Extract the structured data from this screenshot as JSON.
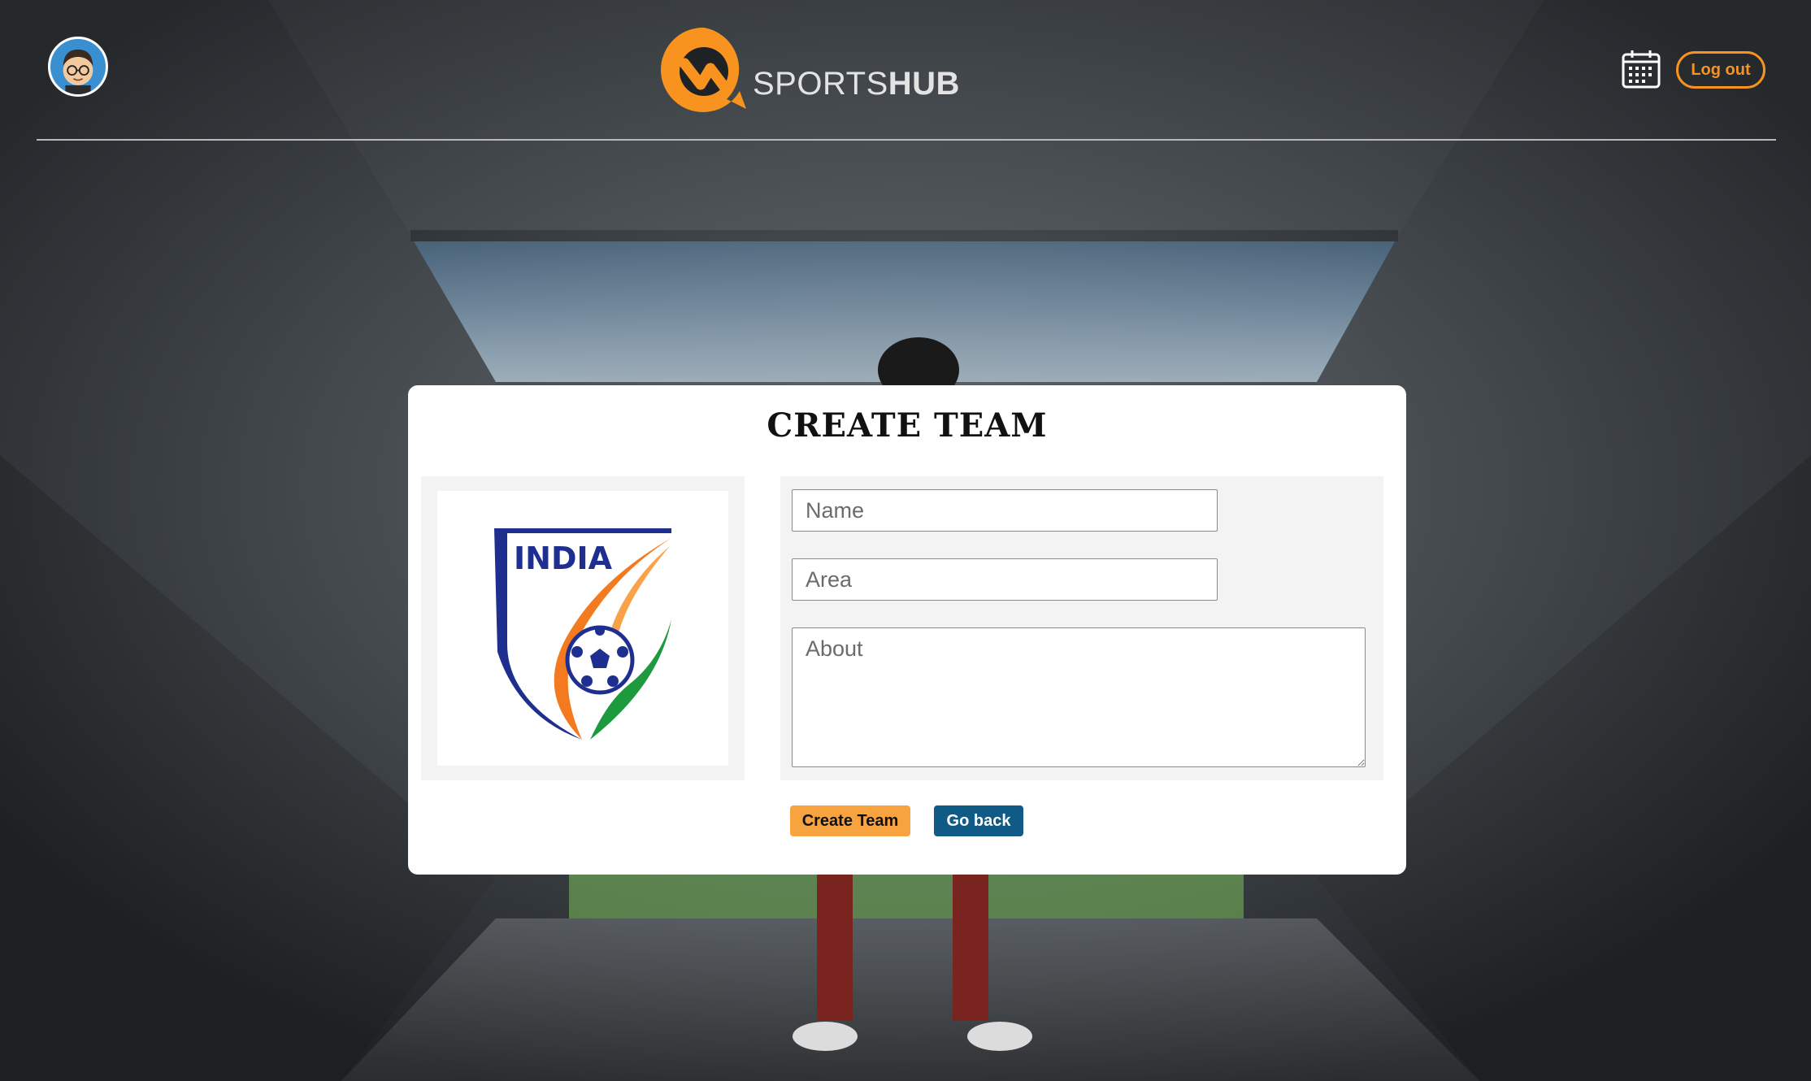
{
  "header": {
    "brand_light": "SPORTS",
    "brand_bold": "HUB",
    "logout_label": "Log out"
  },
  "card": {
    "title": "CREATE TEAM",
    "logo_text": "INDIA",
    "fields": {
      "name_placeholder": "Name",
      "area_placeholder": "Area",
      "about_placeholder": "About"
    },
    "buttons": {
      "create_label": "Create Team",
      "back_label": "Go back"
    }
  },
  "colors": {
    "accent": "#f7931e",
    "create_button": "#f7a440",
    "back_button": "#105b86"
  },
  "icons": [
    "avatar-icon",
    "sportshub-logo-icon",
    "calendar-icon"
  ]
}
